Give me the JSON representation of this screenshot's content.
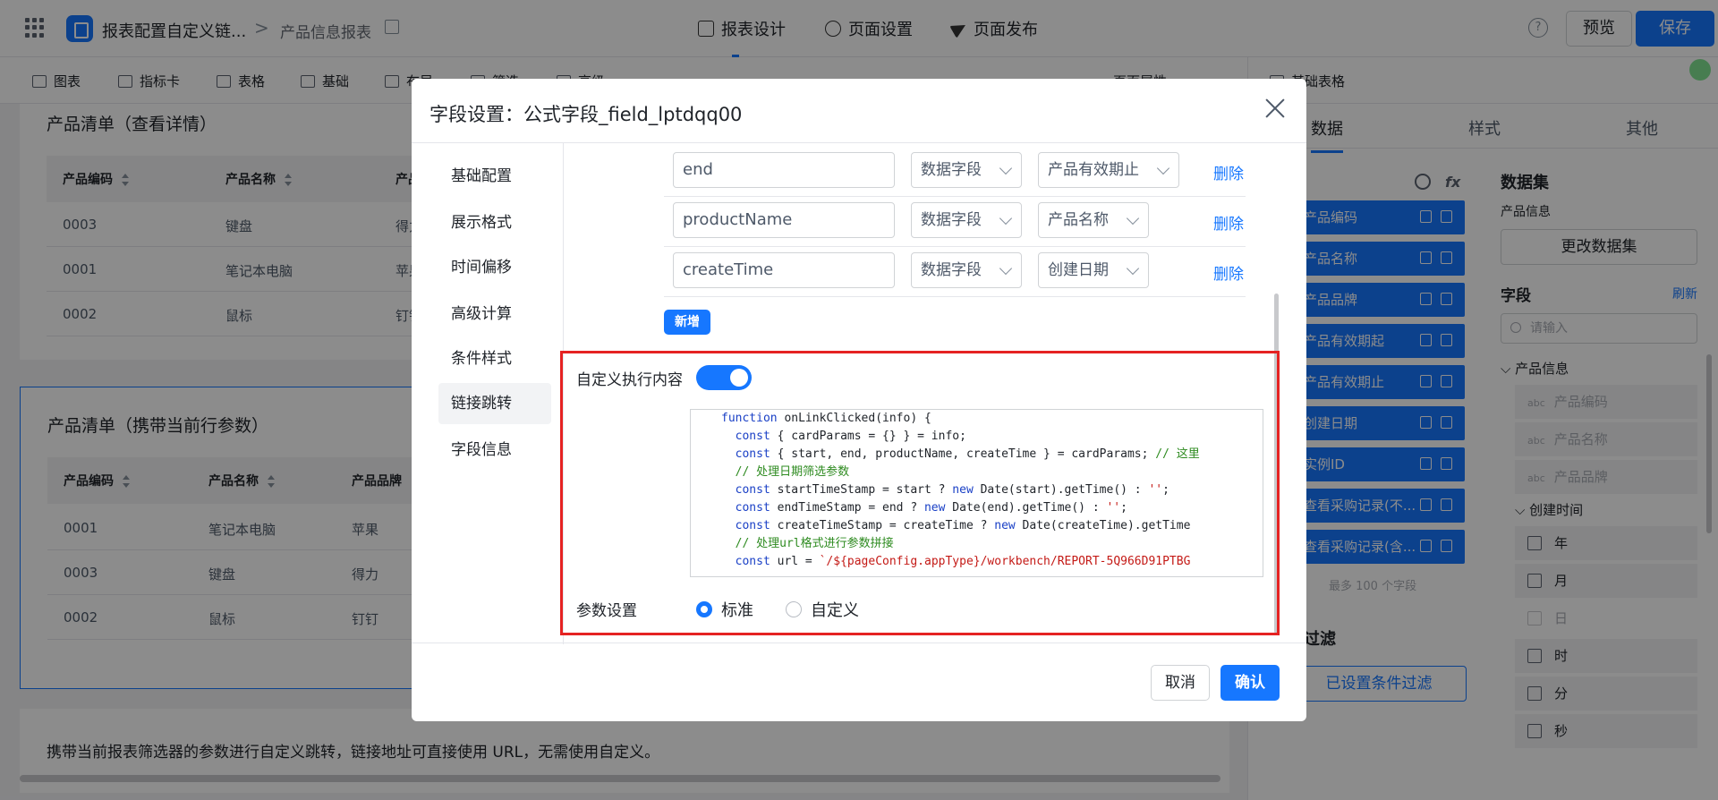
{
  "header": {
    "app_title": "报表配置自定义链...",
    "separator": ">",
    "page_name": "产品信息报表",
    "tabs": [
      "报表设计",
      "页面设置",
      "页面发布"
    ],
    "help": "?",
    "preview_label": "预览",
    "save_label": "保存"
  },
  "toolbar": {
    "items": [
      "图表",
      "指标卡",
      "表格",
      "基础",
      "布局",
      "筛选",
      "高级"
    ],
    "page_attr": "页面属性",
    "basic_table": "基础表格"
  },
  "canvas": {
    "card1": {
      "title": "产品清单（查看详情）",
      "columns": [
        "产品编码",
        "产品名称",
        "产品"
      ],
      "rows": [
        [
          "0003",
          "键盘",
          "得力"
        ],
        [
          "0001",
          "笔记本电脑",
          "苹果"
        ],
        [
          "0002",
          "鼠标",
          "钉钉"
        ]
      ]
    },
    "card2": {
      "title": "产品清单（携带当前行参数）",
      "columns": [
        "产品编码",
        "产品名称",
        "产品品牌"
      ],
      "rows": [
        [
          "0001",
          "笔记本电脑",
          "苹果"
        ],
        [
          "0003",
          "键盘",
          "得力"
        ],
        [
          "0002",
          "鼠标",
          "钉钉"
        ]
      ]
    },
    "note": "携带当前报表筛选器的参数进行自定义跳转，链接地址可直接使用 URL，无需使用自定义。"
  },
  "right_panel": {
    "tabs": [
      "数据",
      "样式",
      "其他"
    ],
    "field_list": [
      "产品编码",
      "产品名称",
      "产品品牌",
      "产品有效期起",
      "产品有效期止",
      "创建日期",
      "实例ID",
      "查看采购记录(不...",
      "查看采购记录(含..."
    ],
    "field_hint": "最多 100 个字段",
    "filter_head": "过滤",
    "filter_button": "已设置条件过滤",
    "dataset_title": "数据集",
    "dataset_name": "产品信息",
    "change_dataset": "更改数据集",
    "fields_title": "字段",
    "refresh": "刷新",
    "search_placeholder": "请输入",
    "tree_root": "产品信息",
    "tree_leaves": [
      "产品编码",
      "产品名称",
      "产品品牌"
    ],
    "abc": "abc",
    "time_node": "创建时间",
    "time_units": [
      "年",
      "月",
      "日",
      "时",
      "分",
      "秒"
    ]
  },
  "modal": {
    "title": "字段设置：公式字段_field_lptdqq00",
    "nav": [
      "基础配置",
      "展示格式",
      "时间偏移",
      "高级计算",
      "条件样式",
      "链接跳转",
      "字段信息"
    ],
    "active_nav": "链接跳转",
    "params": [
      {
        "name": "end",
        "type": "数据字段",
        "field": "产品有效期止",
        "delete": "删除"
      },
      {
        "name": "productName",
        "type": "数据字段",
        "field": "产品名称",
        "delete": "删除"
      },
      {
        "name": "createTime",
        "type": "数据字段",
        "field": "创建日期",
        "delete": "删除"
      }
    ],
    "add_label": "新增",
    "custom_exec_label": "自定义执行内容",
    "custom_exec_enabled": true,
    "code_lines": [
      "function onLinkClicked(info) {",
      "  const { cardParams = {} } = info;",
      "  const { start, end, productName, createTime } = cardParams; // 这里",
      "  // 处理日期筛选参数",
      "  const startTimeStamp = start ? new Date(start).getTime() : '';",
      "  const endTimeStamp = end ? new Date(end).getTime() : '';",
      "  const createTimeStamp = createTime ? new Date(createTime).getTime",
      "  // 处理url格式进行参数拼接",
      "  const url = `/${pageConfig.appType}/workbench/REPORT-5Q966D91PTBG"
    ],
    "param_setting_label": "参数设置",
    "radio_options": [
      "标准",
      "自定义"
    ],
    "radio_selected": "标准",
    "cancel_label": "取消",
    "ok_label": "确认"
  }
}
